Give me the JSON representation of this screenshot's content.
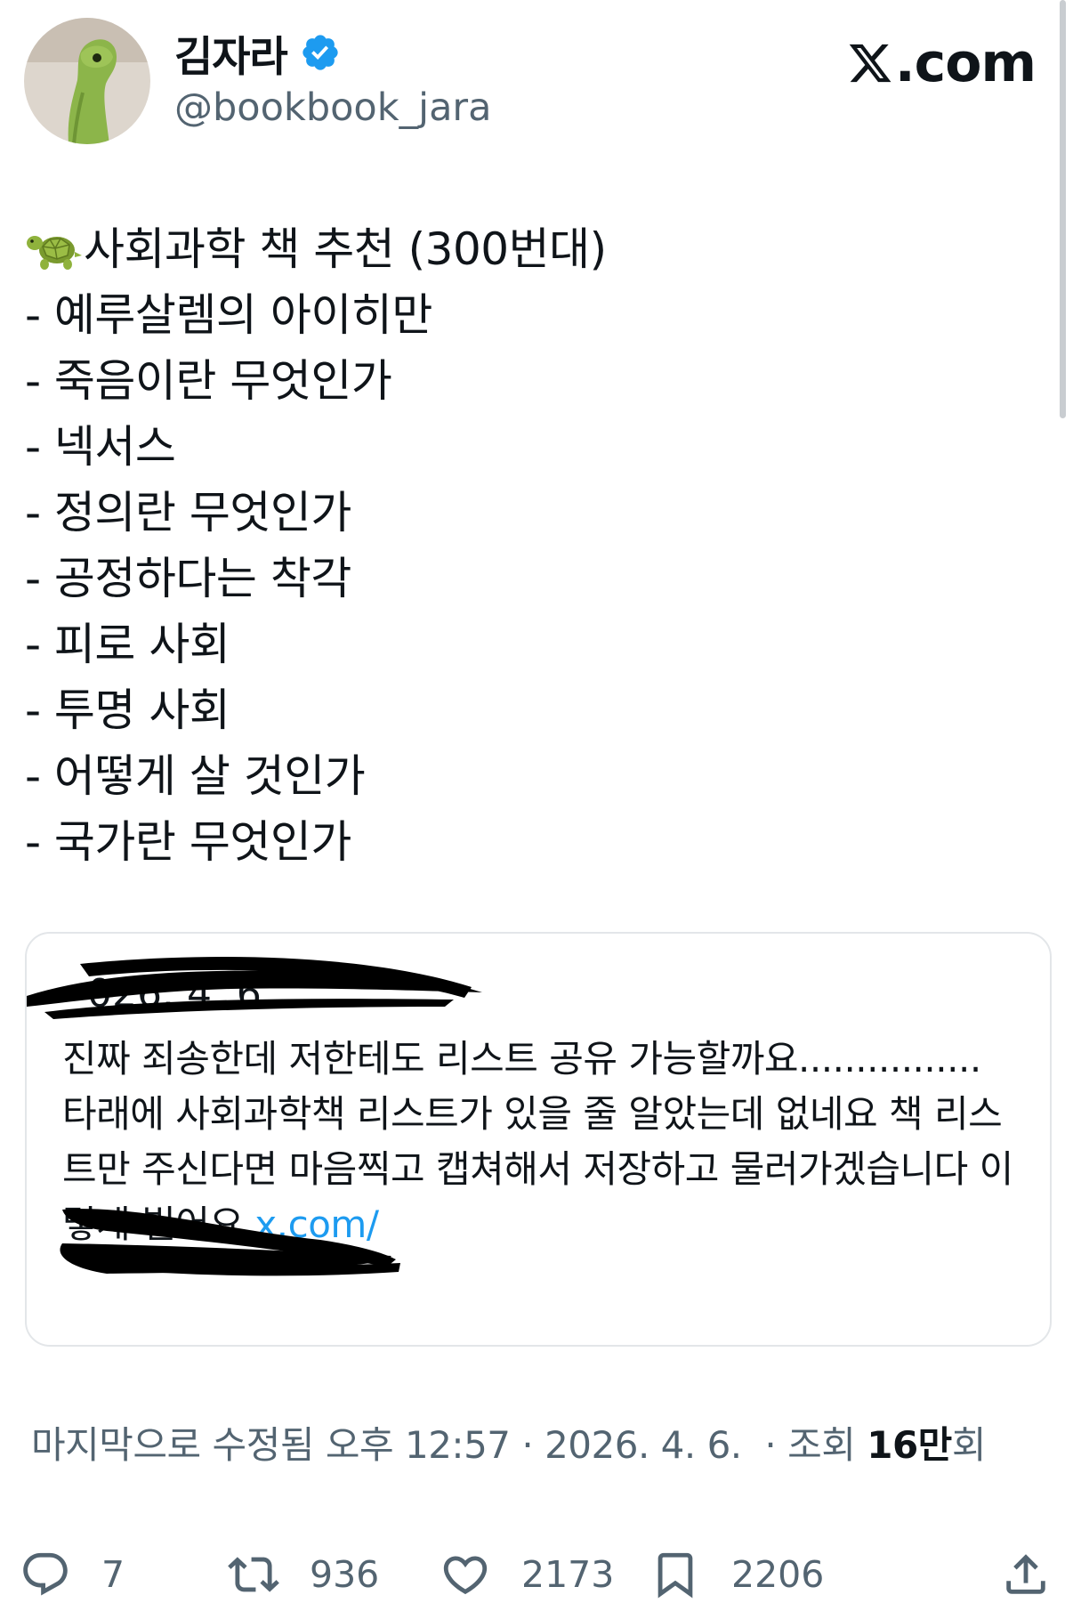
{
  "author": {
    "display_name": "김자라",
    "handle": "@bookbook_jara",
    "verified": true,
    "avatar_icon": "green-plush-toy-avatar"
  },
  "brand": {
    "logo_text": ".com",
    "logo_icon": "x-logo-icon"
  },
  "post": {
    "heading_emoji": "🐢",
    "heading": "사회과학 책 추천 (300번대)",
    "items": [
      "- 예루살렘의 아이히만",
      "- 죽음이란 무엇인가",
      "- 넥서스",
      "- 정의란 무엇인가",
      "- 공정하다는 착각",
      "- 피로 사회",
      "- 투명 사회",
      "- 어떻게 살 것인가",
      "- 국가란 무엇인가"
    ]
  },
  "quote": {
    "date_visible": "026. 4. 6.",
    "text": "진짜 죄송한데 저한테도 리스트 공유 가능할까요................ 타래에 사회과학책 리스트가 있을 줄 알았는데 없네요 책 리스트만 주신다면 마음찍고 캡쳐해서 저장하고 물러가겠습니다 이렇게 빌어요 ",
    "link_visible": "x.com/"
  },
  "meta": {
    "edited_label": "마지막으로 수정됨",
    "time": "오후 12:57",
    "date": "2026. 4. 6.",
    "views_prefix": "조회",
    "views_value": "16만",
    "views_suffix": "회"
  },
  "actions": {
    "reply_count": "7",
    "repost_count": "936",
    "like_count": "2173",
    "bookmark_count": "2206"
  },
  "colors": {
    "link": "#1d9bf0",
    "verified": "#1d9bf0",
    "muted": "#536471",
    "text": "#0f1419"
  }
}
